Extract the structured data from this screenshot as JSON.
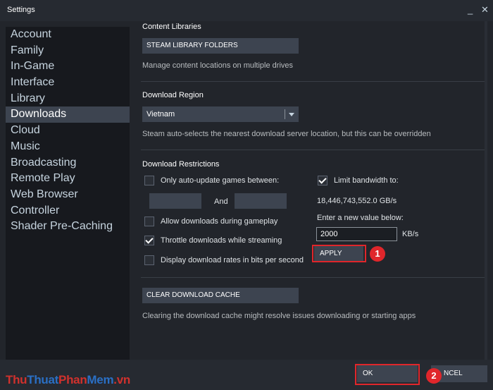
{
  "window": {
    "title": "Settings",
    "controls": [
      "_",
      "✕"
    ]
  },
  "sidebar": {
    "items": [
      {
        "label": "Account"
      },
      {
        "label": "Family"
      },
      {
        "label": "In-Game"
      },
      {
        "label": "Interface"
      },
      {
        "label": "Library"
      },
      {
        "label": "Downloads",
        "active": true
      },
      {
        "label": "Cloud"
      },
      {
        "label": "Music"
      },
      {
        "label": "Broadcasting"
      },
      {
        "label": "Remote Play"
      },
      {
        "label": "Web Browser"
      },
      {
        "label": "Controller"
      },
      {
        "label": "Shader Pre-Caching"
      }
    ]
  },
  "content_libraries": {
    "title": "Content Libraries",
    "button": "STEAM LIBRARY FOLDERS",
    "desc": "Manage content locations on multiple drives"
  },
  "download_region": {
    "title": "Download Region",
    "selected": "Vietnam",
    "desc": "Steam auto-selects the nearest download server location, but this can be overridden"
  },
  "restrictions": {
    "title": "Download Restrictions",
    "auto_update": {
      "label": "Only auto-update games between:",
      "checked": false
    },
    "and_label": "And",
    "allow_gameplay": {
      "label": "Allow downloads during gameplay",
      "checked": false
    },
    "throttle": {
      "label": "Throttle downloads while streaming",
      "checked": true
    },
    "bits": {
      "label": "Display download rates in bits per second",
      "checked": false
    },
    "limit_bandwidth": {
      "label": "Limit bandwidth to:",
      "checked": true
    },
    "bandwidth_value": "18,446,743,552.0 GB/s",
    "enter_new": "Enter a new value below:",
    "input_value": "2000",
    "unit": "KB/s",
    "apply": "APPLY"
  },
  "cache": {
    "button": "CLEAR DOWNLOAD CACHE",
    "desc": "Clearing the download cache might resolve issues downloading or starting apps"
  },
  "footer": {
    "ok": "OK",
    "cancel": "NCEL"
  },
  "annotations": {
    "badge1": "1",
    "badge2": "2",
    "color": "#e0262b"
  },
  "watermark": {
    "parts": [
      "Thu",
      "Thuat",
      "Phan",
      "Mem",
      ".vn"
    ]
  },
  "colors": {
    "accent_highlight": "#e0262b",
    "watermark_red": "#d0312d",
    "watermark_blue": "#2a6fc4"
  }
}
